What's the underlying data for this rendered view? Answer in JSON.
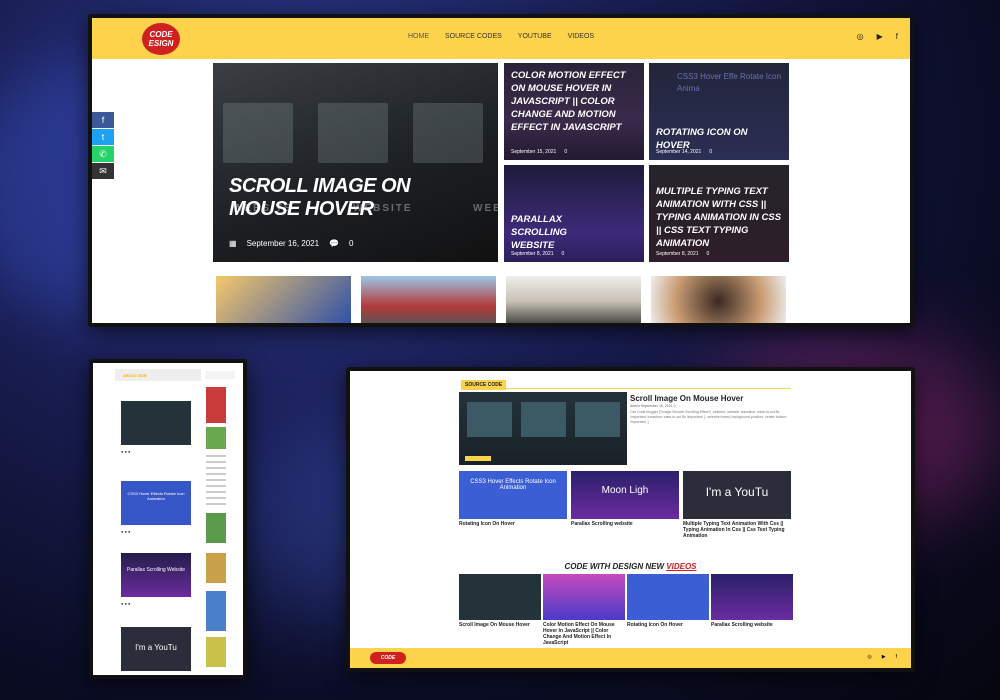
{
  "brand": {
    "logo_line1": "CODE",
    "logo_line2": "ESIGN"
  },
  "nav": {
    "items": [
      "HOME",
      "SOURCE CODES",
      "YOUTUBE",
      "VIDEOS"
    ]
  },
  "header_socials": {
    "instagram": "◎",
    "youtube": "▶",
    "facebook": "f"
  },
  "share_bar": {
    "facebook": "f",
    "twitter": "t",
    "whatsapp": "✆",
    "email": "✉"
  },
  "hero": {
    "title": "Scroll Image On Mouse Hover",
    "date": "September 16, 2021",
    "comments": "0",
    "ghost_word": "WEBSITE"
  },
  "cards": [
    {
      "title": "Color Motion Effect On Mouse Hover In Javascript || Color Change And Motion Effect In Javascript",
      "date": "September 15, 2021",
      "comments": "0"
    },
    {
      "title": "Rotating Icon On Hover",
      "date": "September 14, 2021",
      "comments": "0",
      "bg_text": "CSS3 Hover Effe Rotate Icon Anima"
    },
    {
      "title": "Parallax Scrolling Website",
      "date": "September 8, 2021",
      "comments": "0"
    },
    {
      "title": "Multiple Typing Text Animation With CSS || Typing Animation in CSS || CSS Text Typing Animation",
      "date": "September 8, 2021",
      "comments": "0"
    }
  ],
  "left_page": {
    "header": "ABOUT EDR",
    "posts": [
      "CSS3 Hover Effects Rotate Icon Animation",
      "Parallax Scrolling Website",
      "I'm a YouTu"
    ]
  },
  "right_page": {
    "tag": "SOURCE CODE",
    "featured": {
      "title": "Scroll Image On Mouse Hover",
      "meta": "Admin    September 16, 2021    0",
      "excerpt": "Css Code blogger {*Image Smooth Scrolling Effect*} .selector .website: transition: ease-in-out 8s !important; transition: ease-in-out 8s !important; } .selector:hover{ background-position: center bottom !important; }"
    },
    "cards": [
      {
        "title": "Rotating Icon On Hover",
        "thumb_text": "CSS3 Hover Effects Rotate Icon Animation"
      },
      {
        "title": "Parallax Scrolling website",
        "thumb_text": "Moon Ligh"
      },
      {
        "title": "Multiple Typing Text Animation With Css || Typing Animation In Css || Css Text Typing Animation",
        "thumb_text": "I'm a YouTu"
      }
    ],
    "videos_heading": "CODE WITH DESIGN NEW",
    "videos_word": "VIDEOS",
    "videos": [
      "Scroll Image On Mouse Hover",
      "Color Motion Effect On Mouse Hover In JavaScript || Color Change And Motion Effect In JavaScript",
      "Rotating Icon On Hover",
      "Parallax Scrolling website"
    ],
    "footer_logo": "CODE"
  },
  "colors": {
    "accent": "#fcd34a",
    "brand_red": "#d12020",
    "dark": "#1e1f2c"
  }
}
